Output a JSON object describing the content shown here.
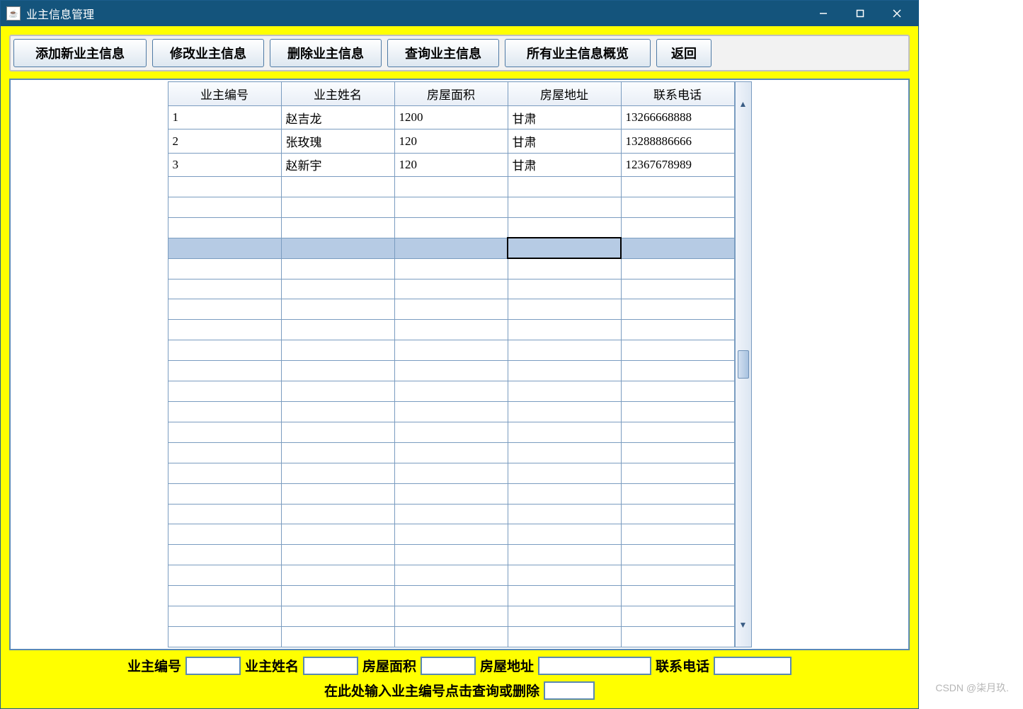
{
  "titlebar": {
    "title": "业主信息管理"
  },
  "toolbar": {
    "add": "添加新业主信息",
    "edit": "修改业主信息",
    "delete": "删除业主信息",
    "query": "查询业主信息",
    "overview": "所有业主信息概览",
    "back": "返回"
  },
  "table": {
    "headers": [
      "业主编号",
      "业主姓名",
      "房屋面积",
      "房屋地址",
      "联系电话"
    ],
    "rows": [
      {
        "id": "1",
        "name": "赵吉龙",
        "area": "1200",
        "address": "甘肃",
        "phone": "13266668888"
      },
      {
        "id": "2",
        "name": "张玫瑰",
        "area": "120",
        "address": "甘肃",
        "phone": "13288886666"
      },
      {
        "id": "3",
        "name": "赵新宇",
        "area": "120",
        "address": "甘肃",
        "phone": "12367678989"
      }
    ],
    "totalVisibleRows": 26,
    "selectedRow": 6,
    "activeCol": 3
  },
  "form": {
    "labels": {
      "id": "业主编号",
      "name": "业主姓名",
      "area": "房屋面积",
      "address": "房屋地址",
      "phone": "联系电话",
      "hint": "在此处输入业主编号点击查询或删除"
    },
    "values": {
      "id": "",
      "name": "",
      "area": "",
      "address": "",
      "phone": "",
      "query_id": ""
    }
  },
  "watermark": "CSDN @柒月玖."
}
